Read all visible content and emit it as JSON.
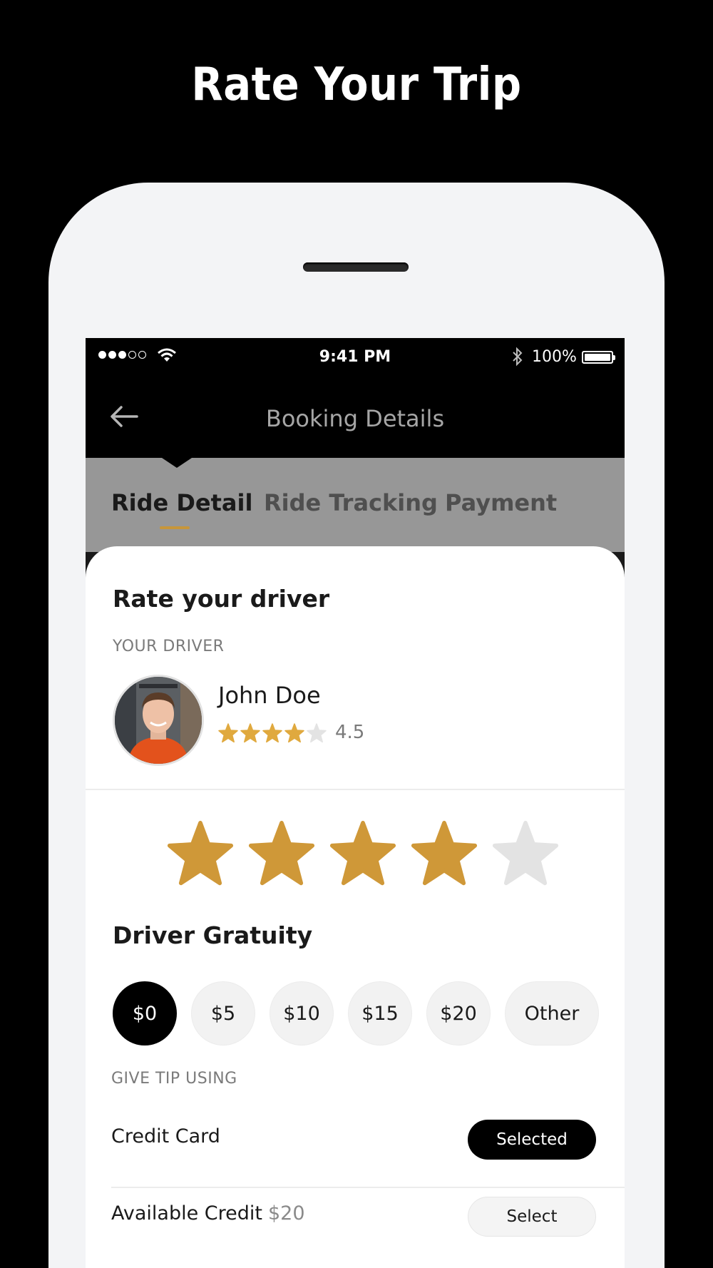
{
  "headline": "Rate Your Trip",
  "status_bar": {
    "time": "9:41 PM",
    "battery": "100%"
  },
  "nav": {
    "title": "Booking Details",
    "back_icon": "arrow-left-icon"
  },
  "tabs": [
    {
      "label": "Ride Detail",
      "active": true
    },
    {
      "label": "Ride Tracking",
      "active": false
    },
    {
      "label": "Payment",
      "active": false
    }
  ],
  "rating": {
    "heading": "Rate your driver",
    "driver_label": "YOUR DRIVER",
    "driver_name": "John Doe",
    "driver_rating": "4.5",
    "driver_rating_value": 4.5,
    "user_rating": 4,
    "max_stars": 5
  },
  "gratuity": {
    "heading": "Driver Gratuity",
    "options": [
      "$0",
      "$5",
      "$10",
      "$15",
      "$20",
      "Other"
    ],
    "selected": "$0"
  },
  "tip_method": {
    "label": "GIVE TIP USING",
    "rows": [
      {
        "label": "Credit Card",
        "extra": "",
        "button": "Selected",
        "selected": true
      },
      {
        "label": "Available Credit",
        "extra": "$20",
        "button": "Select",
        "selected": false
      }
    ]
  },
  "colors": {
    "accent": "#c7963a",
    "star_filled": "#cf9838",
    "star_empty": "#e3e3e3",
    "mini_star_filled": "#e0a93e"
  }
}
